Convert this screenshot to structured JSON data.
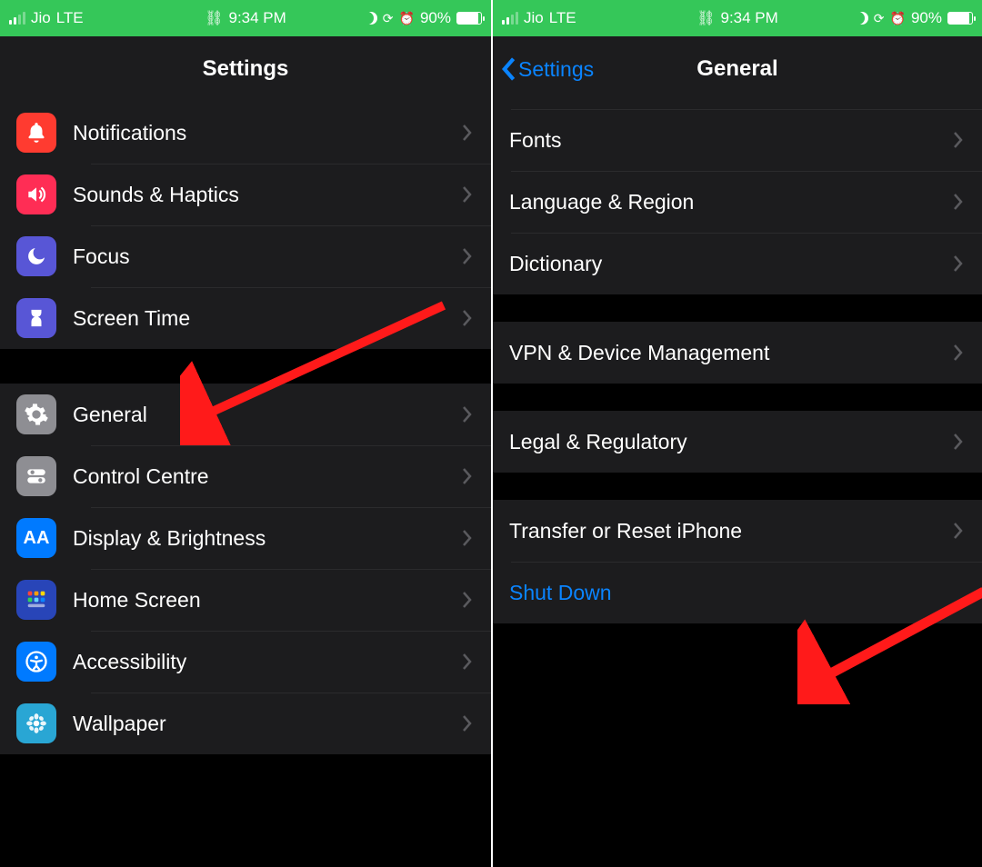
{
  "status": {
    "carrier": "Jio",
    "network": "LTE",
    "time": "9:34 PM",
    "battery_pct": "90%"
  },
  "left": {
    "title": "Settings",
    "group1": [
      {
        "id": "notifications",
        "label": "Notifications"
      },
      {
        "id": "sounds",
        "label": "Sounds & Haptics"
      },
      {
        "id": "focus",
        "label": "Focus"
      },
      {
        "id": "screentime",
        "label": "Screen Time"
      }
    ],
    "group2": [
      {
        "id": "general",
        "label": "General"
      },
      {
        "id": "controlcentre",
        "label": "Control Centre"
      },
      {
        "id": "display",
        "label": "Display & Brightness"
      },
      {
        "id": "homescreen",
        "label": "Home Screen"
      },
      {
        "id": "accessibility",
        "label": "Accessibility"
      },
      {
        "id": "wallpaper",
        "label": "Wallpaper"
      }
    ]
  },
  "right": {
    "back_label": "Settings",
    "title": "General",
    "group1": [
      {
        "id": "fonts",
        "label": "Fonts"
      },
      {
        "id": "langregion",
        "label": "Language & Region"
      },
      {
        "id": "dictionary",
        "label": "Dictionary"
      }
    ],
    "group2": [
      {
        "id": "vpn",
        "label": "VPN & Device Management"
      }
    ],
    "group3": [
      {
        "id": "legal",
        "label": "Legal & Regulatory"
      }
    ],
    "group4": [
      {
        "id": "transfer",
        "label": "Transfer or Reset iPhone"
      },
      {
        "id": "shutdown",
        "label": "Shut Down",
        "link": true,
        "no_chevron": true
      }
    ]
  }
}
